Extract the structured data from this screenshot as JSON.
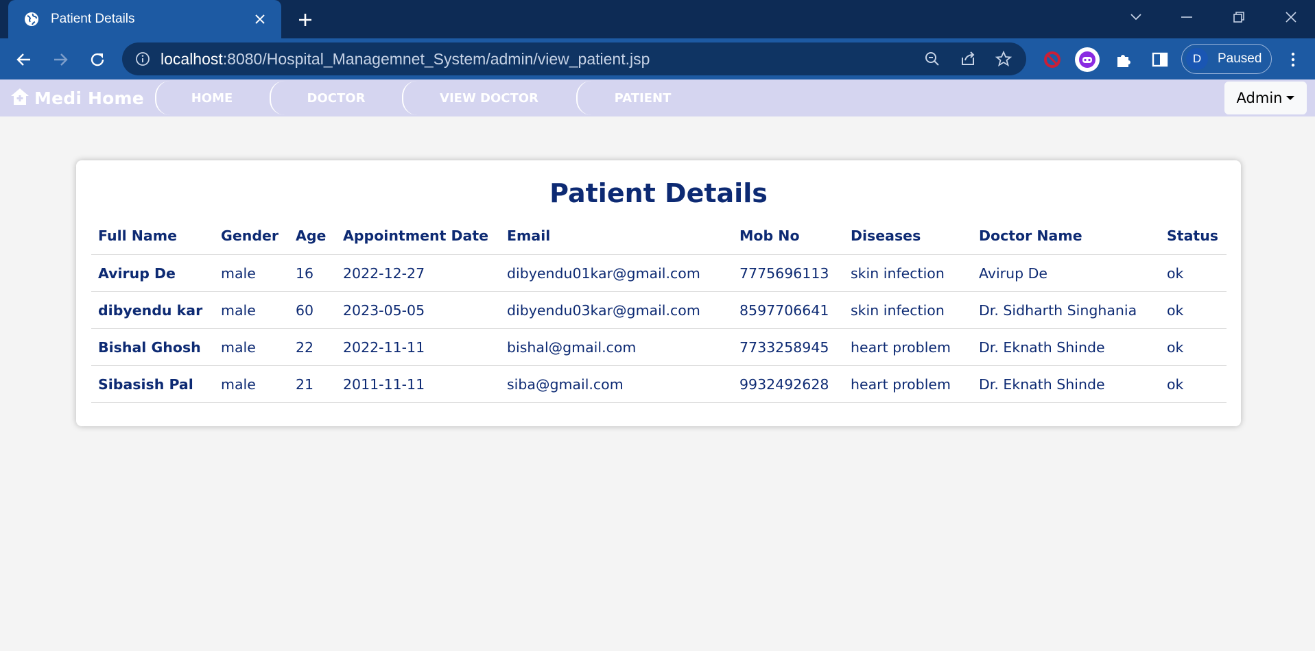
{
  "browser": {
    "tab_title": "Patient Details",
    "url_host": "localhost",
    "url_rest": ":8080/Hospital_Managemnet_System/admin/view_patient.jsp",
    "profile_initial": "D",
    "profile_status": "Paused"
  },
  "navbar": {
    "brand": "Medi Home",
    "links": [
      "HOME",
      "DOCTOR",
      "VIEW DOCTOR",
      "PATIENT"
    ],
    "admin_label": "Admin"
  },
  "card": {
    "title": "Patient Details",
    "columns": [
      "Full Name",
      "Gender",
      "Age",
      "Appointment Date",
      "Email",
      "Mob No",
      "Diseases",
      "Doctor Name",
      "Status"
    ],
    "rows": [
      [
        "Avirup De",
        "male",
        "16",
        "2022-12-27",
        "dibyendu01kar@gmail.com",
        "7775696113",
        "skin infection",
        "Avirup De",
        "ok"
      ],
      [
        "dibyendu kar",
        "male",
        "60",
        "2023-05-05",
        "dibyendu03kar@gmail.com",
        "8597706641",
        "skin infection",
        "Dr. Sidharth Singhania",
        "ok"
      ],
      [
        "Bishal Ghosh",
        "male",
        "22",
        "2022-11-11",
        "bishal@gmail.com",
        "7733258945",
        "heart problem",
        "Dr. Eknath Shinde",
        "ok"
      ],
      [
        "Sibasish Pal",
        "male",
        "21",
        "2011-11-11",
        "siba@gmail.com",
        "9932492628",
        "heart problem",
        "Dr. Eknath Shinde",
        "ok"
      ]
    ]
  },
  "colors": {
    "tabstrip": "#0d2b55",
    "toolbar": "#1d5aa3",
    "navbar": "#d5d5f0",
    "heading": "#0d2a73"
  }
}
